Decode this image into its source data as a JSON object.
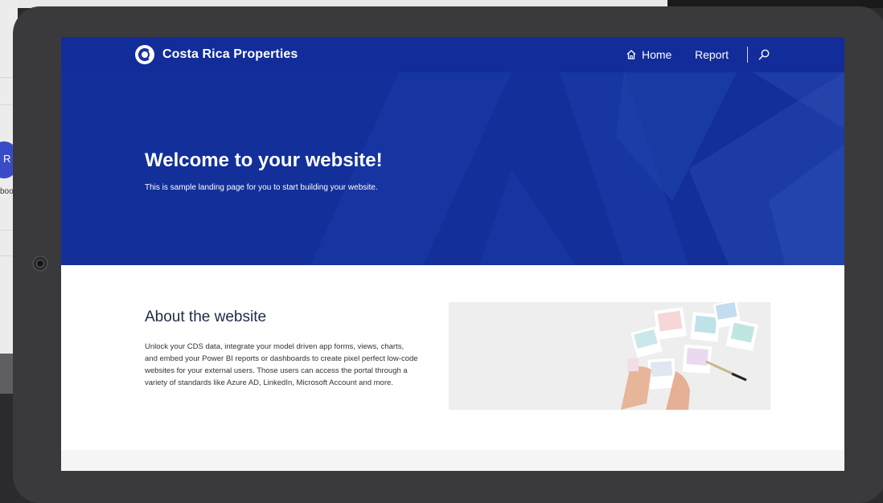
{
  "site": {
    "brand": "Costa Rica Properties"
  },
  "nav": {
    "home_label": "Home",
    "report_label": "Report"
  },
  "hero": {
    "title": "Welcome to your website!",
    "subtitle": "This is sample landing page for you to start building your website."
  },
  "about": {
    "title": "About the website",
    "body": "Unlock your CDS data, integrate your model driven app forms, views, charts, and embed your Power BI reports or dashboards to create pixel perfect low-code websites for your external users. Those users can access the portal through a variety of standards like Azure AD, LinkedIn, Microsoft Account and more."
  },
  "background": {
    "avatar_glyph": "R",
    "label_fragment": "boo"
  },
  "colors": {
    "nav": "#122d9a",
    "hero": "#13309a",
    "device": "#3a3a3c"
  },
  "icons": [
    "home-icon",
    "search-icon",
    "logo-icon",
    "camera-icon"
  ]
}
